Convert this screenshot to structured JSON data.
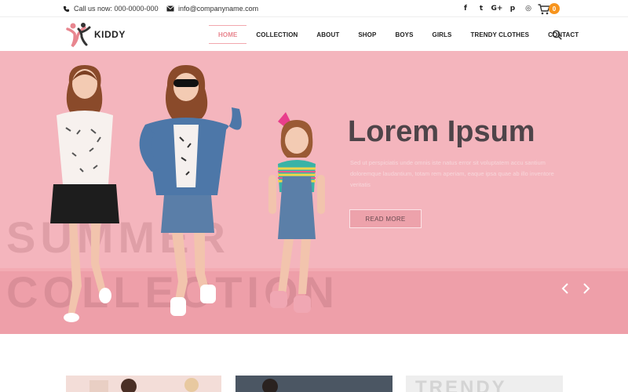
{
  "topbar": {
    "phone": "Call us now: 000-0000-000",
    "email": "info@companyname.com",
    "socials": [
      {
        "icon": "facebook-icon",
        "glyph": "f"
      },
      {
        "icon": "twitter-icon",
        "glyph": "t"
      },
      {
        "icon": "google-plus-icon",
        "glyph": "G+"
      },
      {
        "icon": "pinterest-icon",
        "glyph": "p"
      },
      {
        "icon": "instagram-icon",
        "glyph": "◎"
      }
    ],
    "cart_count": "0"
  },
  "header": {
    "logo_text": "KIDDY",
    "nav": [
      "HOME",
      "COLLECTION",
      "ABOUT",
      "SHOP",
      "BOYS",
      "GIRLS",
      "TRENDY CLOTHES",
      "CONTACT"
    ],
    "active_nav": "HOME"
  },
  "hero": {
    "bg_text_line1": "SUMMER",
    "bg_text_line2": "COLLECTION",
    "title": "Lorem Ipsum",
    "description": "Sed ut perspiciatis unde omnis iste natus error sit voluptatem accu santium doloremque laudantium, totam rem aperiam, eaque ipsa quae ab illo inventore veritatis",
    "button": "READ MORE"
  },
  "cards": {
    "card3_text": "TRENDY"
  },
  "colors": {
    "hero_bg": "#f4b5bd",
    "accent": "#f7941d",
    "nav_active": "#e8868f",
    "title": "#4e4449"
  }
}
